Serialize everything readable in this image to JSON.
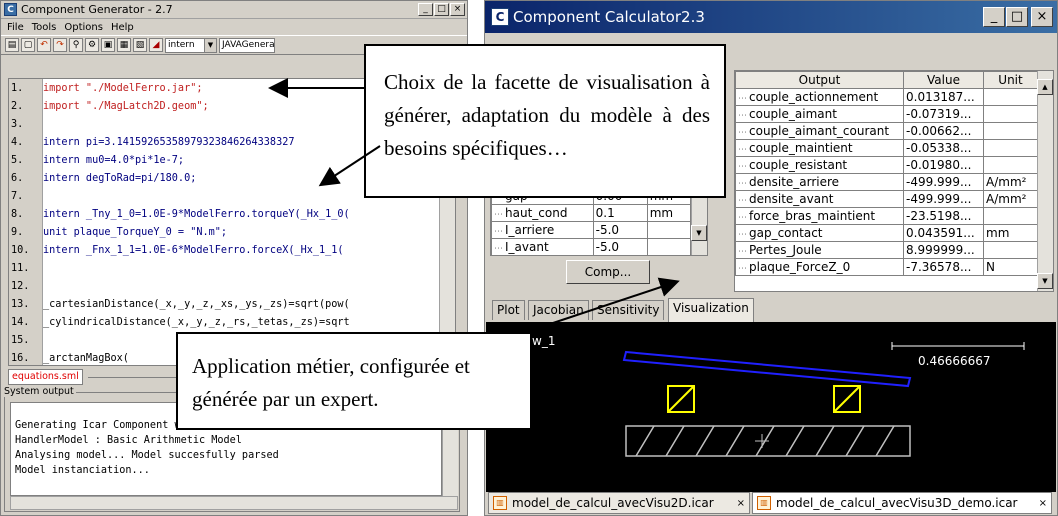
{
  "left_window": {
    "title": "Component Generator - 2.7",
    "icon_letter": "C",
    "buttons": {
      "minimize": "_",
      "maximize": "□",
      "close": "×"
    },
    "menu": [
      "File",
      "Tools",
      "Options",
      "Help"
    ],
    "toolbar": {
      "facet_select": "intern",
      "generator_select": "JAVAGenerat"
    },
    "editor_lines": [
      {
        "n": "1.",
        "text": "import \"./ModelFerro.jar\";"
      },
      {
        "n": "2.",
        "text": "import \"./MagLatch2D.geom\";"
      },
      {
        "n": "3.",
        "text": ""
      },
      {
        "n": "4.",
        "text": "intern pi=3.14159265358979323846264338327"
      },
      {
        "n": "5.",
        "text": "intern mu0=4.0*pi*1e-7;"
      },
      {
        "n": "6.",
        "text": "intern degToRad=pi/180.0;"
      },
      {
        "n": "7.",
        "text": ""
      },
      {
        "n": "8.",
        "text": "intern _Tny_1_0=1.0E-9*ModelFerro.torqueY(_Hx_1_0("
      },
      {
        "n": "9.",
        "text": "unit plaque_TorqueY_0 = \"N.m\";"
      },
      {
        "n": "10.",
        "text": "intern _Fnx_1_1=1.0E-6*ModelFerro.forceX(_Hx_1_1("
      },
      {
        "n": "11.",
        "text": ""
      },
      {
        "n": "12.",
        "text": ""
      },
      {
        "n": "13.",
        "text": "_cartesianDistance(_x,_y,_z,_xs,_ys,_zs)=sqrt(pow("
      },
      {
        "n": "14.",
        "text": "_cylindricalDistance(_x,_y,_z,_rs,_tetas,_zs)=sqrt"
      },
      {
        "n": "15.",
        "text": ""
      },
      {
        "n": "16.",
        "text": "_arctanMagBox("
      }
    ],
    "file_tab": "equations.sml",
    "system_output_label": "System output",
    "system_output_lines": [
      "",
      "Generating Icar Component with: JavaGenerator",
      "HandlerModel : Basic Arithmetic Model",
      "Analysing model... Model succesfully parsed",
      "Model instanciation..."
    ]
  },
  "right_window": {
    "title": "Component Calculator2.3",
    "icon_letter": "C",
    "buttons": {
      "minimize": "_",
      "maximize": "□",
      "close": "×"
    },
    "inputs_visible": [
      {
        "name": "gap",
        "value": "0.00",
        "unit": "mm"
      },
      {
        "name": "haut_cond",
        "value": "0.1",
        "unit": "mm"
      },
      {
        "name": "I_arriere",
        "value": "-5.0",
        "unit": ""
      },
      {
        "name": "I_avant",
        "value": "-5.0",
        "unit": ""
      }
    ],
    "compute_button": "Comp...",
    "output_headers": {
      "output": "Output",
      "value": "Value",
      "unit": "Unit"
    },
    "outputs": [
      {
        "name": "couple_actionnement",
        "value": "0.013187...",
        "unit": ""
      },
      {
        "name": "couple_aimant",
        "value": "-0.07319...",
        "unit": ""
      },
      {
        "name": "couple_aimant_courant",
        "value": "-0.00662...",
        "unit": ""
      },
      {
        "name": "couple_maintient",
        "value": "-0.05338...",
        "unit": ""
      },
      {
        "name": "couple_resistant",
        "value": "-0.01980...",
        "unit": ""
      },
      {
        "name": "densite_arriere",
        "value": "-499.999...",
        "unit": "A/mm²"
      },
      {
        "name": "densite_avant",
        "value": "-499.999...",
        "unit": "A/mm²"
      },
      {
        "name": "force_bras_maintient",
        "value": "-23.5198...",
        "unit": ""
      },
      {
        "name": "gap_contact",
        "value": "0.043591...",
        "unit": "mm"
      },
      {
        "name": "Pertes_Joule",
        "value": "8.999999...",
        "unit": ""
      },
      {
        "name": "plaque_ForceZ_0",
        "value": "-7.36578...",
        "unit": "N"
      }
    ],
    "tabs": [
      "Plot",
      "Jacobian",
      "Sensitivity",
      "Visualization"
    ],
    "active_tab": "Visualization",
    "viz": {
      "view_label": "w_1",
      "scale_value": "0.46666667"
    },
    "doc_tabs": [
      "model_de_calcul_avecVisu2D.icar",
      "model_de_calcul_avecVisu3D_demo.icar"
    ],
    "doc_tab_close": "×"
  },
  "callouts": {
    "top": "Choix de la facette de visualisation à générer, adaptation du modèle à des besoins spécifiques…",
    "bottom": "Application métier, configurée et générée par un expert."
  },
  "colors": {
    "title_blue": "#0a246a",
    "window_gray": "#d4d0c8",
    "string_red": "#c02020",
    "keyword_blue": "#000080",
    "viz_blue": "#2020ff",
    "viz_yellow": "#ffff00"
  }
}
